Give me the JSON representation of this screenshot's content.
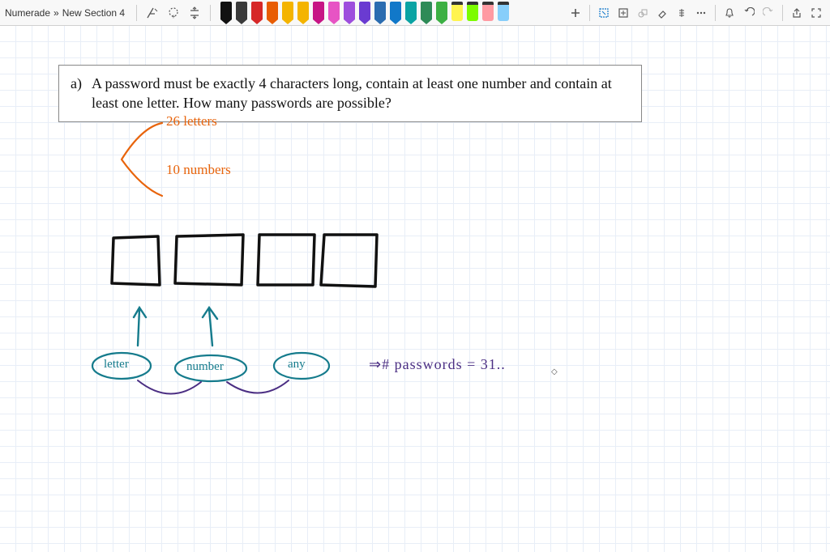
{
  "breadcrumb": {
    "root": "Numerade",
    "sep": "»",
    "section": "New Section 4"
  },
  "toolbar": {
    "pens": [
      {
        "color": "#111111"
      },
      {
        "color": "#3a3a3a"
      },
      {
        "color": "#d62828"
      },
      {
        "color": "#e85d04"
      },
      {
        "color": "#f4b400"
      },
      {
        "color": "#f4b400"
      },
      {
        "color": "#c71585"
      },
      {
        "color": "#e754c4"
      },
      {
        "color": "#9d4edd"
      },
      {
        "color": "#6a3bd1"
      },
      {
        "color": "#2b6cb0"
      },
      {
        "color": "#1178c9"
      },
      {
        "color": "#0aa3a3"
      },
      {
        "color": "#2e8b57"
      },
      {
        "color": "#3cb043"
      }
    ],
    "highlighters": [
      {
        "color": "#fff44f"
      },
      {
        "color": "#7CFC00"
      },
      {
        "color": "#ff9aa2"
      },
      {
        "color": "#87CEFA"
      }
    ]
  },
  "question": {
    "label": "a)",
    "text": "A password must be exactly 4 characters long, contain at least one number and contain at least one letter. How many passwords are possible?"
  },
  "handwriting": {
    "letters_note": "26 letters",
    "numbers_note": "10 numbers",
    "bubble_letter": "letter",
    "bubble_number": "number",
    "bubble_any": "any",
    "result": "⇒# passwords = 31..",
    "colors": {
      "orange": "#e8640c",
      "black": "#111111",
      "teal": "#157b8c",
      "purple": "#4b2e83"
    }
  }
}
